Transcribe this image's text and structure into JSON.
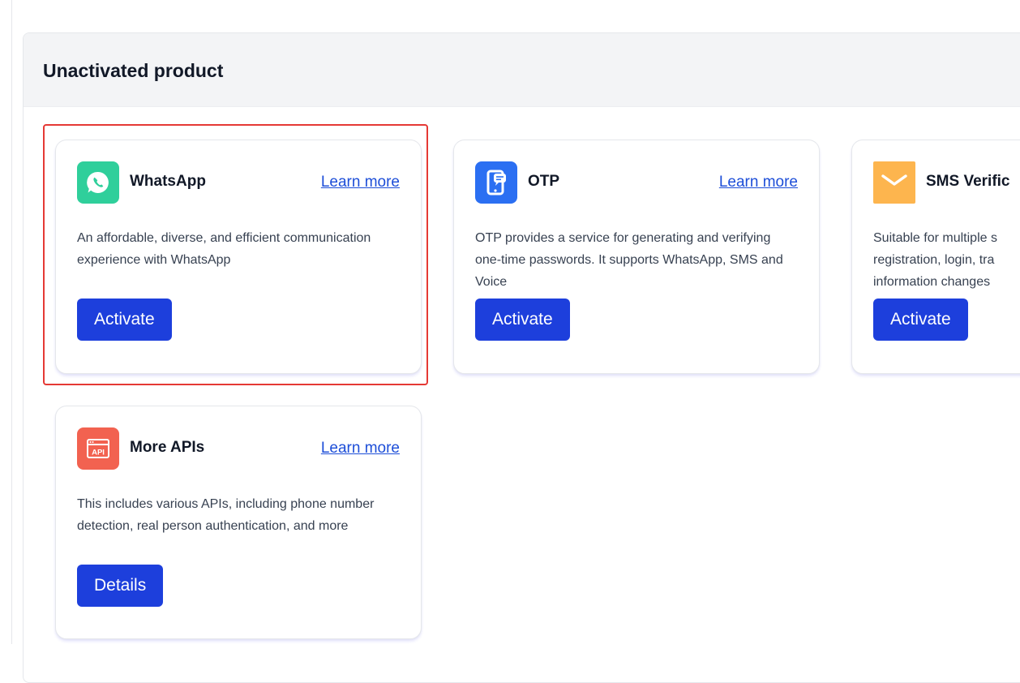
{
  "section": {
    "title": "Unactivated product"
  },
  "colors": {
    "button": "#1d3fdc",
    "link": "#1d4ed8",
    "highlight": "#e53935"
  },
  "cards": [
    {
      "name": "WhatsApp",
      "icon": "whatsapp-icon",
      "icon_color": "#2fcf9b",
      "learn_more": "Learn more",
      "description": "An affordable, diverse, and efficient communication experience with WhatsApp",
      "button": "Activate"
    },
    {
      "name": "OTP",
      "icon": "otp-phone-icon",
      "icon_color": "#2b6ff2",
      "learn_more": "Learn more",
      "description": "OTP provides a service for generating and verifying one-time passwords. It supports WhatsApp, SMS and Voice",
      "button": "Activate"
    },
    {
      "name": "SMS Verific",
      "icon": "envelope-icon",
      "icon_color": "#fdb54e",
      "learn_more": "",
      "description": "Suitable for multiple s registration, login, tra information changes",
      "button": "Activate"
    },
    {
      "name": "More APIs",
      "icon": "api-icon",
      "icon_color": "#f26250",
      "learn_more": "Learn more",
      "description": "This includes various APIs, including phone number detection, real person authentication, and more",
      "button": "Details"
    }
  ]
}
